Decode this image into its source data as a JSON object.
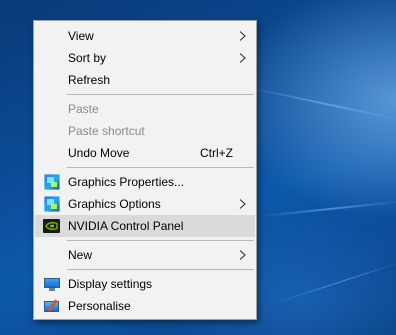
{
  "context_menu": {
    "items": [
      {
        "id": "view",
        "label": "View",
        "submenu": true
      },
      {
        "id": "sort-by",
        "label": "Sort by",
        "submenu": true
      },
      {
        "id": "refresh",
        "label": "Refresh"
      },
      {
        "id": "paste",
        "label": "Paste",
        "disabled": true
      },
      {
        "id": "paste-shortcut",
        "label": "Paste shortcut",
        "disabled": true
      },
      {
        "id": "undo-move",
        "label": "Undo Move",
        "shortcut": "Ctrl+Z"
      },
      {
        "id": "graphics-properties",
        "label": "Graphics Properties...",
        "icon": "intel-graphics-icon"
      },
      {
        "id": "graphics-options",
        "label": "Graphics Options",
        "icon": "intel-graphics-icon",
        "submenu": true
      },
      {
        "id": "nvidia-control-panel",
        "label": "NVIDIA Control Panel",
        "icon": "nvidia-icon",
        "highlighted": true
      },
      {
        "id": "new",
        "label": "New",
        "submenu": true
      },
      {
        "id": "display-settings",
        "label": "Display settings",
        "icon": "display-settings-icon"
      },
      {
        "id": "personalise",
        "label": "Personalise",
        "icon": "personalise-icon"
      }
    ]
  },
  "colors": {
    "menu_background": "#f2f2f2",
    "hover_background": "#dadada",
    "disabled_text": "#8a8a8a",
    "nvidia_green": "#76b900",
    "desktop_blue": "#0b4a95"
  }
}
